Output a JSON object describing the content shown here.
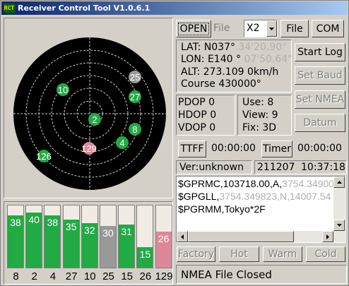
{
  "window": {
    "title": "Receiver Control Tool V1.0.6.1",
    "icon_text": "RCT"
  },
  "toolbar": {
    "open_label": "OPEN",
    "file_label": "File",
    "port_value": "X2",
    "file_button": "File",
    "com_button": "COM"
  },
  "position": {
    "lat": "LAT:  N037°",
    "lat_hidden": "34'20.90\"",
    "lon": "LON: E140 °",
    "lon_hidden": "07'50.64\"",
    "alt": "ALT: 273.109 0km/h",
    "course": "Course 430000°"
  },
  "actions": {
    "start_log": "Start Log",
    "set_baud": "Set Baud",
    "set_nmea": "Set NMEA",
    "datum": "Datum"
  },
  "dop": {
    "pdop": "PDOP  0",
    "hdop": "HDOP 0",
    "vdop": "VDOP 0"
  },
  "sats": {
    "use": "Use: 8",
    "view": "View: 9",
    "fix": "Fix: 3D"
  },
  "timing": {
    "ttff_button": "TTFF",
    "ttff_value": "00:00:00",
    "timer_button": "Timer",
    "timer_value": "00:00:00"
  },
  "info": {
    "version": "Ver:unknown",
    "date": "211207",
    "time": "10:37:18"
  },
  "nmea": {
    "lines": [
      {
        "text": "$GPRMC,103718.00,A,",
        "hidden": "3754.34900,N"
      },
      {
        "text": "$GPGLL,",
        "hidden": "3754.349823,N,14007.54"
      },
      {
        "text": "$PGRMM,Tokyo*2F",
        "hidden": ""
      }
    ]
  },
  "bottom_buttons": {
    "factory": "Factory",
    "hot": "Hot",
    "warm": "Warm",
    "cold": "Cold"
  },
  "status": {
    "text": "NMEA File Closed"
  },
  "colors": {
    "used": "#22aa44",
    "unused": "#999999",
    "weak": "#dd8899"
  },
  "satellites": [
    {
      "prn": "8",
      "snr": "38",
      "state": "used"
    },
    {
      "prn": "2",
      "snr": "40",
      "state": "used"
    },
    {
      "prn": "4",
      "snr": "38",
      "state": "used"
    },
    {
      "prn": "27",
      "snr": "35",
      "state": "used"
    },
    {
      "prn": "10",
      "snr": "32",
      "state": "used"
    },
    {
      "prn": "25",
      "snr": "30",
      "state": "unused"
    },
    {
      "prn": "15",
      "snr": "31",
      "state": "used"
    },
    {
      "prn": "26",
      "snr": "15",
      "state": "used"
    },
    {
      "prn": "129",
      "snr": "26",
      "state": "weak"
    }
  ]
}
